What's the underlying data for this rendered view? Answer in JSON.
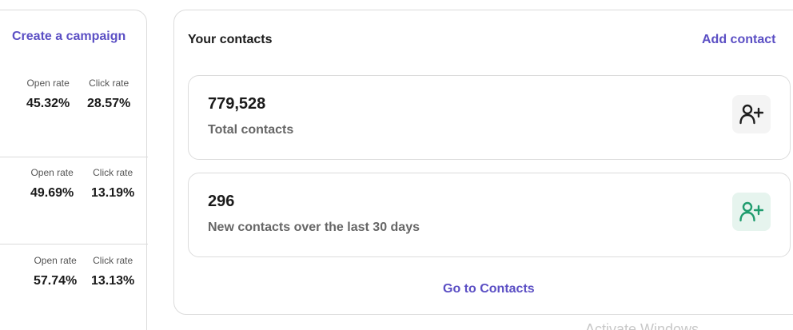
{
  "campaigns": {
    "create_label": "Create a campaign",
    "rows": [
      {
        "open_label": "Open rate",
        "open_value": "45.32%",
        "click_label": "Click rate",
        "click_value": "28.57%"
      },
      {
        "open_label": "Open rate",
        "open_value": "49.69%",
        "click_label": "Click rate",
        "click_value": "13.19%"
      },
      {
        "open_label": "Open rate",
        "open_value": "57.74%",
        "click_label": "Click rate",
        "click_value": "13.13%"
      }
    ]
  },
  "contacts": {
    "title": "Your contacts",
    "add_label": "Add contact",
    "total": {
      "value": "779,528",
      "label": "Total contacts",
      "icon": "add-user-icon"
    },
    "new": {
      "value": "296",
      "label": "New contacts over the last 30 days",
      "icon": "add-user-icon"
    },
    "go_label": "Go to Contacts"
  },
  "watermark": "Activate Windows",
  "colors": {
    "accent": "#5b4fc4",
    "icon_dark": "#1f1f1f",
    "icon_green": "#1f9c6e"
  }
}
